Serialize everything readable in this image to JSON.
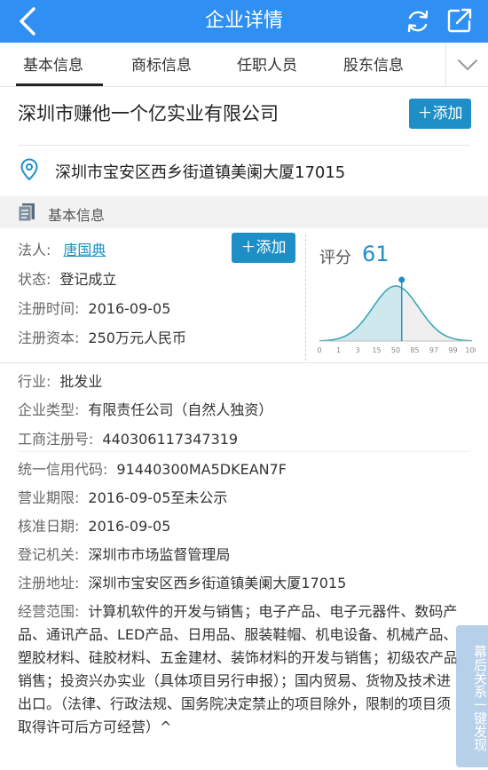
{
  "header": {
    "title": "企业详情"
  },
  "tabs": [
    {
      "label": "基本信息",
      "active": true
    },
    {
      "label": "商标信息"
    },
    {
      "label": "任职人员"
    },
    {
      "label": "股东信息"
    }
  ],
  "company": {
    "name": "深圳市赚他一个亿实业有限公司",
    "add_label": "添加",
    "address": "深圳市宝安区西乡街道镇美阑大厦17015"
  },
  "section": {
    "title": "基本信息"
  },
  "info": {
    "legal_key": "法人:",
    "legal_val": "唐国典",
    "legal_add": "添加",
    "status_key": "状态:",
    "status_val": "登记成立",
    "reg_time_key": "注册时间:",
    "reg_time_val": "2016-09-05",
    "capital_key": "注册资本:",
    "capital_val": "250万元人民币",
    "industry_key": "行业:",
    "industry_val": "批发业",
    "type_key": "企业类型:",
    "type_val": "有限责任公司（自然人独资）",
    "regno_key": "工商注册号:",
    "regno_val": "440306117347319",
    "credit_key": "统一信用代码:",
    "credit_val": "91440300MA5DKEAN7F",
    "term_key": "营业期限:",
    "term_val": "2016-09-05至未公示",
    "approve_key": "核准日期:",
    "approve_val": "2016-09-05",
    "authority_key": "登记机关:",
    "authority_val": "深圳市市场监督管理局",
    "addr_key": "注册地址:",
    "addr_val": "深圳市宝安区西乡街道镇美阑大厦17015",
    "scope_key": "经营范围:",
    "scope_val": "计算机软件的开发与销售；电子产品、电子元器件、数码产品、通讯产品、LED产品、日用品、服装鞋帽、机电设备、机械产品、塑胶材料、硅胶材料、五金建材、装饰材料的开发与销售；初级农产品销售；投资兴办实业（具体项目另行申报）；国内贸易、货物及技术进出口。（法律、行政法规、国务院决定禁止的项目除外，限制的项目须取得许可后方可经营）^"
  },
  "score": {
    "label": "评分",
    "value": "61",
    "value_num": 61,
    "ticks": [
      "0",
      "1",
      "3",
      "15",
      "50",
      "85",
      "97",
      "99",
      "100"
    ],
    "accent": "#1e8fc6"
  },
  "float_button": {
    "label": "幕后关系一键发现"
  },
  "colors": {
    "header": "#2f8ff3",
    "accent": "#1e8fc6"
  }
}
